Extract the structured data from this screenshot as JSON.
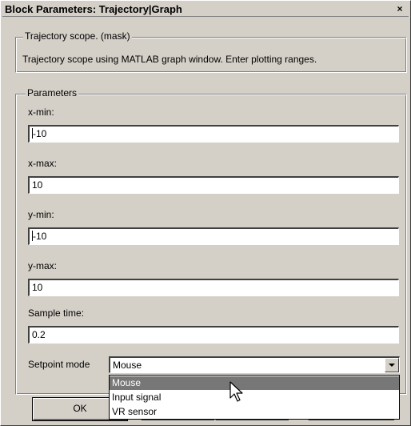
{
  "window": {
    "title": "Block Parameters: Trajectory|Graph",
    "close_glyph": "×"
  },
  "mask_group": {
    "label": "Trajectory scope. (mask)",
    "description": "Trajectory scope using MATLAB graph window. Enter plotting ranges."
  },
  "params_group": {
    "label": "Parameters",
    "fields": [
      {
        "label": "x-min:",
        "value": "-10"
      },
      {
        "label": "x-max:",
        "value": "10"
      },
      {
        "label": "y-min:",
        "value": "-10"
      },
      {
        "label": "y-max:",
        "value": "10"
      },
      {
        "label": "Sample time:",
        "value": "0.2"
      }
    ],
    "setpoint": {
      "label": "Setpoint mode",
      "value": "Mouse",
      "options": [
        "Mouse",
        "Input signal",
        "VR sensor"
      ],
      "highlighted_index": 0
    }
  },
  "buttons": {
    "ok": "OK"
  },
  "icons": {
    "close": "close-icon",
    "dropdown": "chevron-down-icon",
    "cursor": "mouse-pointer-icon"
  },
  "colors": {
    "face": "#d4d0c8",
    "highlight": "#777777"
  }
}
